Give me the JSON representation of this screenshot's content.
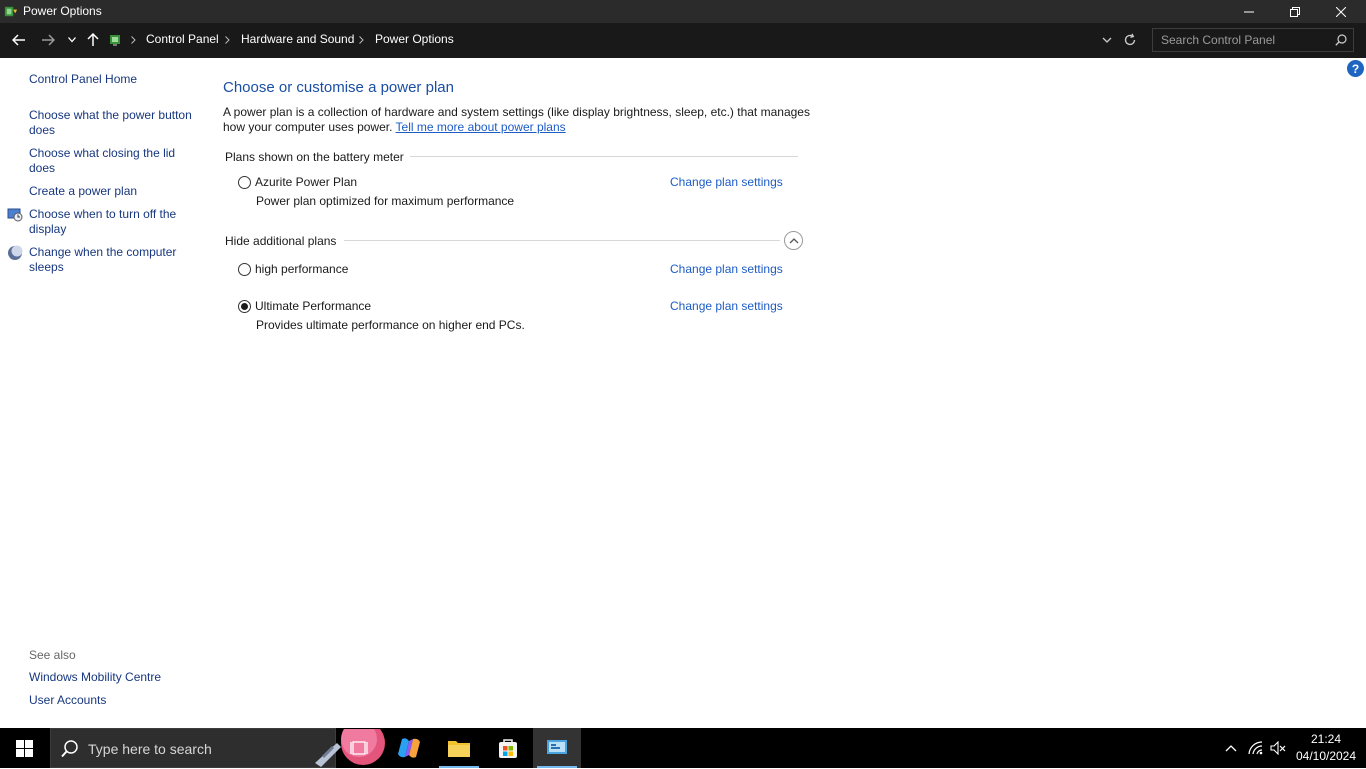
{
  "window": {
    "title": "Power Options",
    "minimize_label": "Minimize",
    "restore_label": "Restore Down",
    "close_label": "Close"
  },
  "address": {
    "crumbs": [
      "Control Panel",
      "Hardware and Sound",
      "Power Options"
    ],
    "search_placeholder": "Search Control Panel"
  },
  "sidebar": {
    "home": "Control Panel Home",
    "items": [
      {
        "label_line1": "Choose what the power button",
        "label_line2": "does"
      },
      {
        "label_line1": "Choose what closing the lid",
        "label_line2": "does"
      },
      {
        "label_line1": "Create a power plan",
        "label_line2": ""
      },
      {
        "label_line1": "Choose when to turn off the",
        "label_line2": "display",
        "icon": "display-power-icon"
      },
      {
        "label_line1": "Change when the computer",
        "label_line2": "sleeps",
        "icon": "sleep-moon-icon"
      }
    ],
    "see_also_label": "See also",
    "see_also": [
      "Windows Mobility Centre",
      "User Accounts"
    ]
  },
  "main": {
    "title": "Choose or customise a power plan",
    "description": "A power plan is a collection of hardware and system settings (like display brightness, sleep, etc.) that manages how your computer uses power.",
    "learn_more_link": "Tell me more about power plans",
    "battery_meter_header": "Plans shown on the battery meter",
    "additional_header": "Hide additional plans",
    "change_settings_label": "Change plan settings",
    "plans": [
      {
        "name": "Azurite Power Plan",
        "description": "Power plan optimized for maximum performance",
        "selected": false
      },
      {
        "name": "high performance",
        "description": "",
        "selected": false
      },
      {
        "name": "Ultimate Performance",
        "description": "Provides ultimate performance on higher end PCs.",
        "selected": true
      }
    ]
  },
  "taskbar": {
    "search_text": "Type here to search",
    "time": "21:24",
    "date": "04/10/2024",
    "accent_color": "#76b9ed"
  },
  "colors": {
    "link": "#1d5cc5",
    "title_blue": "#1a4fa3",
    "titlebar_bg": "#2b2b2b",
    "addressbar_bg": "#191919"
  }
}
